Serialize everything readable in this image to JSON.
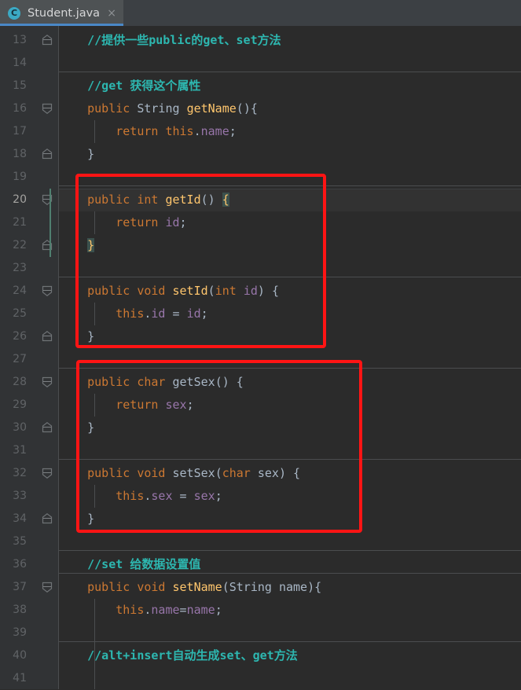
{
  "window": {
    "theme": "darcula",
    "bg_editor": "#2b2b2b",
    "bg_gutter": "#313335",
    "bg_tabbar": "#3c4044"
  },
  "tabbar": {
    "tabs": [
      {
        "label": "Student.java",
        "icon": "java-class-icon",
        "icon_letter": "C",
        "active": true,
        "close_label": "×",
        "underline_color": "#4a88c7"
      }
    ]
  },
  "editor": {
    "first_line_number": 13,
    "current_line_number": 20,
    "line_height": 29,
    "lines": [
      {
        "n": 13,
        "fold": "up",
        "text": "    //提供一些public的get、set方法"
      },
      {
        "n": 14,
        "fold": null,
        "text": ""
      },
      {
        "n": 15,
        "fold": null,
        "text": "    //get 获得这个属性"
      },
      {
        "n": 16,
        "fold": "down",
        "text": "    public String getName(){"
      },
      {
        "n": 17,
        "fold": null,
        "text": "        return this.name;"
      },
      {
        "n": 18,
        "fold": "up",
        "text": "    }"
      },
      {
        "n": 19,
        "fold": null,
        "text": ""
      },
      {
        "n": 20,
        "fold": "down",
        "text": "    public int getId() {"
      },
      {
        "n": 21,
        "fold": null,
        "text": "        return id;"
      },
      {
        "n": 22,
        "fold": "up",
        "text": "    }"
      },
      {
        "n": 23,
        "fold": null,
        "text": ""
      },
      {
        "n": 24,
        "fold": "down",
        "text": "    public void setId(int id) {"
      },
      {
        "n": 25,
        "fold": null,
        "text": "        this.id = id;"
      },
      {
        "n": 26,
        "fold": "up",
        "text": "    }"
      },
      {
        "n": 27,
        "fold": null,
        "text": ""
      },
      {
        "n": 28,
        "fold": "down",
        "text": "    public char getSex() {"
      },
      {
        "n": 29,
        "fold": null,
        "text": "        return sex;"
      },
      {
        "n": 30,
        "fold": "up",
        "text": "    }"
      },
      {
        "n": 31,
        "fold": null,
        "text": ""
      },
      {
        "n": 32,
        "fold": "down",
        "text": "    public void setSex(char sex) {"
      },
      {
        "n": 33,
        "fold": null,
        "text": "        this.sex = sex;"
      },
      {
        "n": 34,
        "fold": "up",
        "text": "    }"
      },
      {
        "n": 35,
        "fold": null,
        "text": ""
      },
      {
        "n": 36,
        "fold": null,
        "text": "    //set 给数据设置值"
      },
      {
        "n": 37,
        "fold": "down",
        "text": "    public void setName(String name){"
      },
      {
        "n": 38,
        "fold": null,
        "text": "        this.name=name;"
      },
      {
        "n": 39,
        "fold": null,
        "text": ""
      },
      {
        "n": 40,
        "fold": null,
        "text": "    //alt+insert自动生成set、get方法"
      },
      {
        "n": 41,
        "fold": null,
        "text": ""
      }
    ]
  },
  "annotations": {
    "boxes": [
      {
        "label": "getId-setId-highlight",
        "color": "#ff1414",
        "lines": "20-26"
      },
      {
        "label": "getSex-setSex-highlight",
        "color": "#ff1414",
        "lines": "28-34"
      }
    ]
  },
  "syntax_colors": {
    "keyword": "#cc7832",
    "type": "#a9b7c6",
    "method_declaration": "#ffc66d",
    "field": "#9876aa",
    "comment": "#2db7b0",
    "brace_match_bg": "#3b514d",
    "brace_match_fg": "#ffc66d"
  }
}
